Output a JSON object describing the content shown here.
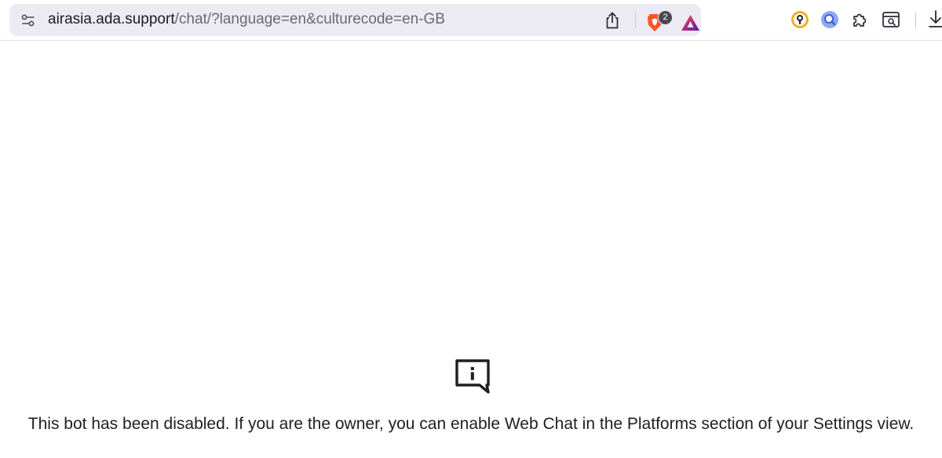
{
  "browser": {
    "address_bar": {
      "url_host": "airasia.ada.support",
      "url_path": "/chat/?language=en&culturecode=en-GB"
    },
    "shields": {
      "badge_count": "2"
    },
    "icons": {
      "site_settings": "site-settings-icon",
      "share": "share-icon",
      "shields": "brave-shields-icon",
      "rewards": "brave-rewards-icon",
      "extensions": [
        "keychain-extension-icon",
        "search-extension-icon",
        "extensions-puzzle-icon",
        "reader-view-icon"
      ],
      "download": "download-icon"
    },
    "colors": {
      "brave_orange": "#fb542b",
      "rewards_purple": "#6a2c9a"
    }
  },
  "page": {
    "icon": "info-chat-icon",
    "message": "This bot has been disabled. If you are the owner, you can enable Web Chat in the Platforms section of your Settings view."
  }
}
